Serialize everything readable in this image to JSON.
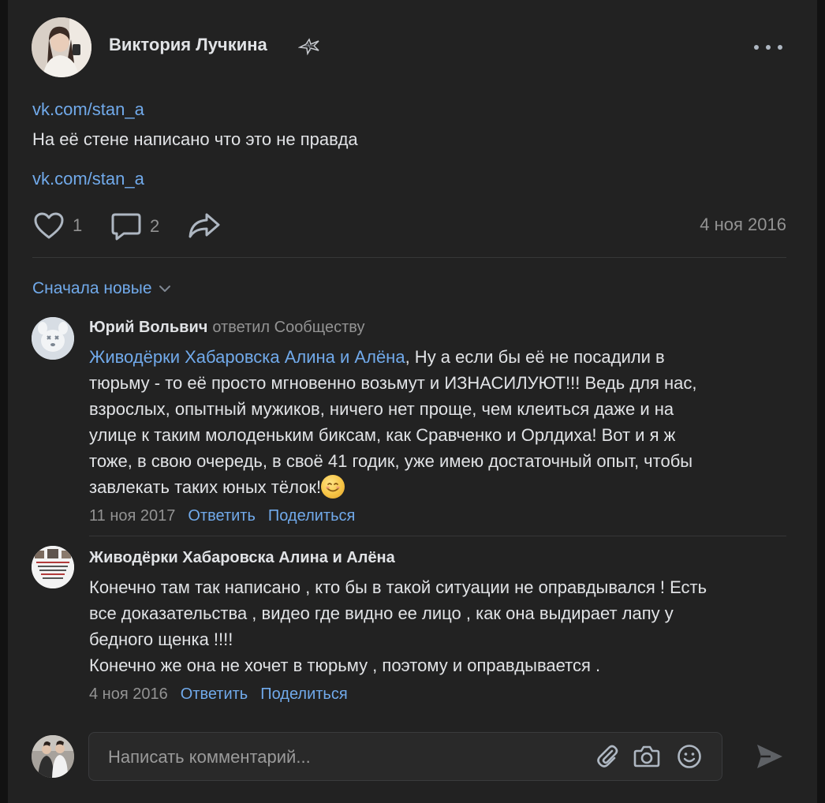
{
  "post": {
    "author": {
      "name": "Виктория Лучкина"
    },
    "links": [
      "vk.com/stan_a",
      "vk.com/stan_a"
    ],
    "text": "На её стене написано что это не правда",
    "likes": "1",
    "comments_count": "2",
    "date": "4 ноя 2016"
  },
  "comments_section": {
    "sort_label": "Сначала новые",
    "comments": [
      {
        "author": "Юрий Вольвич",
        "reply_to": "ответил Сообществу",
        "mention": "Живодёрки Хабаровска Алина и Алёна",
        "text_lines": [
          ", Ну а если бы её не посадили в",
          "тюрьму - то её просто мгновенно возьмут и ИЗНАСИЛУЮТ!!! Ведь для нас,",
          "взрослых, опытный мужиков, ничего нет проще, чем клеиться даже и на",
          "улице к таким молоденьким биксам, как Сравченко и Орлдиха! Вот и я ж",
          "тоже, в свою очередь, в своё 41 годик, уже имею достаточный опыт, чтобы",
          "завлекать таких юных тёлок!"
        ],
        "date": "11 ноя 2017",
        "reply_label": "Ответить",
        "share_label": "Поделиться"
      },
      {
        "author": "Живодёрки Хабаровска Алина и Алёна",
        "text_lines": [
          "Конечно там так написано , кто бы в такой ситуации не оправдывался ! Есть",
          "все доказательства , видео где видно ее лицо , как она выдирает лапу у",
          "бедного щенка !!!!",
          "Конечно же она не хочет в тюрьму , поэтому и оправдывается ."
        ],
        "date": "4 ноя 2016",
        "reply_label": "Ответить",
        "share_label": "Поделиться"
      }
    ]
  },
  "composer": {
    "placeholder": "Написать комментарий..."
  },
  "icons": {
    "like": "heart-icon",
    "comment": "comment-bubble-icon",
    "share": "share-arrow-icon",
    "more": "more-horizontal-icon",
    "sort": "chevron-down-icon",
    "attach": "paperclip-icon",
    "camera": "camera-icon",
    "emoji": "smile-icon",
    "send": "send-icon"
  },
  "colors": {
    "background": "#222222",
    "page": "#121212",
    "text": "#e1e3e6",
    "secondary": "#939393",
    "link": "#71aaeb",
    "icon": "#aeb7c2"
  }
}
